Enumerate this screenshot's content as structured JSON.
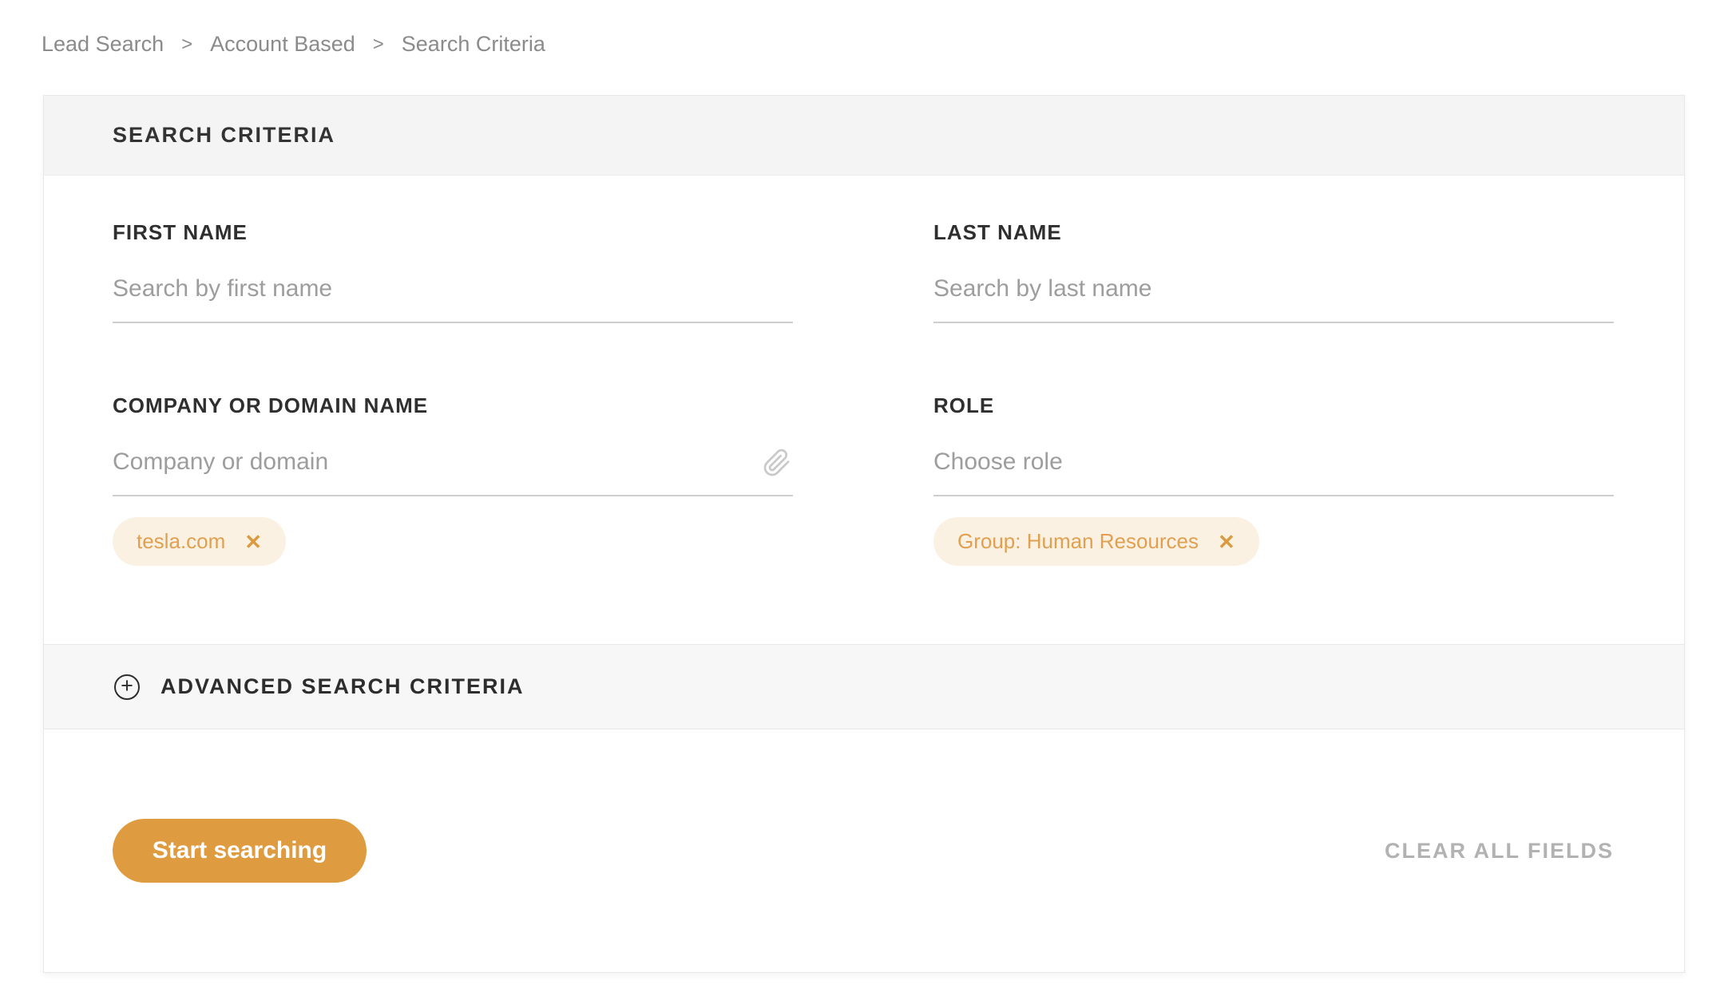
{
  "breadcrumb": {
    "separator": ">",
    "items": [
      "Lead Search",
      "Account Based",
      "Search Criteria"
    ]
  },
  "card": {
    "header": {
      "title": "SEARCH CRITERIA"
    },
    "fields": {
      "first_name": {
        "label": "FIRST NAME",
        "placeholder": "Search by first name",
        "value": ""
      },
      "last_name": {
        "label": "LAST NAME",
        "placeholder": "Search by last name",
        "value": ""
      },
      "company": {
        "label": "COMPANY OR DOMAIN NAME",
        "placeholder": "Company or domain",
        "value": "",
        "tags": [
          {
            "label": "tesla.com"
          }
        ]
      },
      "role": {
        "label": "ROLE",
        "placeholder": "Choose role",
        "value": "",
        "tags": [
          {
            "label": "Group: Human Resources"
          }
        ]
      }
    },
    "advanced": {
      "label": "ADVANCED SEARCH CRITERIA"
    },
    "footer": {
      "search_button": "Start searching",
      "clear_button": "CLEAR ALL FIELDS"
    }
  },
  "icons": {
    "plus_glyph": "+",
    "close_glyph": "✕"
  },
  "colors": {
    "accent_orange": "#df9b3f",
    "tag_background": "#faf1e2",
    "tag_text": "#e0a050",
    "header_band": "#f4f4f4",
    "advanced_band": "#f7f7f7",
    "card_border": "#e7e7e7",
    "breadcrumb_gray": "#8b8b8b",
    "placeholder_gray": "#9d9d9d",
    "clear_gray": "#b2b2b2",
    "label_dark": "#2f2f2f"
  }
}
